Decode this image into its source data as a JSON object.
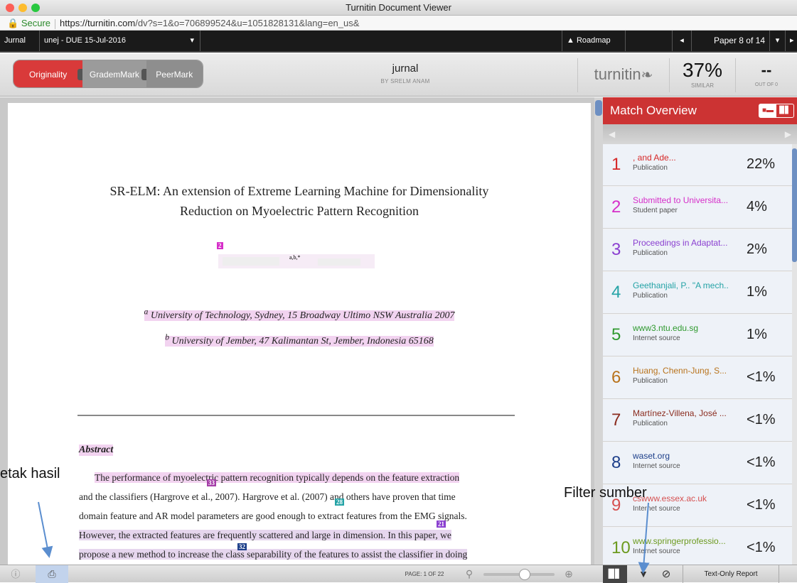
{
  "window": {
    "title": "Turnitin Document Viewer"
  },
  "address": {
    "secure": "Secure",
    "url_domain": "https://turnitin.com",
    "url_path": "/dv?s=1&o=706899524&u=1051828131&lang=en_us&"
  },
  "topbar": {
    "class": "Jurnal",
    "assignment": "unej - DUE 15-Jul-2016",
    "roadmap": "Roadmap",
    "paper": "Paper 8 of 14"
  },
  "tabs": {
    "originality": "Originality",
    "grademark": "GrademMark",
    "peermark": "PeerMark"
  },
  "doc": {
    "title": "jurnal",
    "author": "BY SRELM ANAM"
  },
  "brand": {
    "logo": "turnitin"
  },
  "similarity": {
    "value": "37%",
    "label": "SIMILAR"
  },
  "outof": {
    "value": "--",
    "label": "OUT OF 0"
  },
  "paper": {
    "title_line1": "SR-ELM: An extension of Extreme Learning Machine for Dimensionality",
    "title_line2": "Reduction on Myoelectric Pattern Recognition",
    "affil_a_sup": "a",
    "affil_a": "University of Technology, Sydney, 15 Broadway Ultimo NSW Australia 2007",
    "affil_b_sup": "b",
    "affil_b": "University of Jember, 47 Kalimantan St, Jember, Indonesia 65168",
    "author_sup": "a,b,*",
    "abstract_heading": "Abstract",
    "abstract_lines": [
      "The performance of myoelectric pattern recognition typically depends on the feature extraction",
      "and the classifiers (Hargrove et al., 2007). Hargrove et al. (2007) and others have proven that time",
      "domain feature and AR model parameters are good enough to extract features from the EMG signals.",
      "However, the extracted features are frequently scattered and large in dimension. In this paper, we",
      "propose a new method to increase the class separability of the features to assist the classifier in doing"
    ],
    "markers": {
      "m2": "2",
      "m33": "33",
      "m28": "28",
      "m21": "21",
      "m32": "32"
    }
  },
  "panel": {
    "title": "Match Overview",
    "matches": [
      {
        "num": "1",
        "name": ", and Ade...",
        "type": "Publication",
        "pct": "22%",
        "color": "#d62828"
      },
      {
        "num": "2",
        "name": "Submitted to Universita...",
        "type": "Student paper",
        "pct": "4%",
        "color": "#d62fc9"
      },
      {
        "num": "3",
        "name": "Proceedings in Adaptat...",
        "type": "Publication",
        "pct": "2%",
        "color": "#8a3fd0"
      },
      {
        "num": "4",
        "name": "Geethanjali, P.. \"A mech..",
        "type": "Publication",
        "pct": "1%",
        "color": "#24a3a6"
      },
      {
        "num": "5",
        "name": "www3.ntu.edu.sg",
        "type": "Internet source",
        "pct": "1%",
        "color": "#2f9a2f"
      },
      {
        "num": "6",
        "name": "Huang, Chenn-Jung, S...",
        "type": "Publication",
        "pct": "<1%",
        "color": "#b8731c"
      },
      {
        "num": "7",
        "name": "Martínez-Villena, José ...",
        "type": "Publication",
        "pct": "<1%",
        "color": "#8a2b1e"
      },
      {
        "num": "8",
        "name": "waset.org",
        "type": "Internet source",
        "pct": "<1%",
        "color": "#1d3f8a"
      },
      {
        "num": "9",
        "name": "cswww.essex.ac.uk",
        "type": "Internet source",
        "pct": "<1%",
        "color": "#d65050"
      },
      {
        "num": "10",
        "name": "www.springerprofessio...",
        "type": "Internet source",
        "pct": "<1%",
        "color": "#6c9a1f"
      }
    ]
  },
  "bottom": {
    "page": "PAGE:  1 OF 22",
    "text_only": "Text-Only Report"
  },
  "annotations": {
    "cetak": "etak hasil",
    "filter": "Filter sumber"
  }
}
